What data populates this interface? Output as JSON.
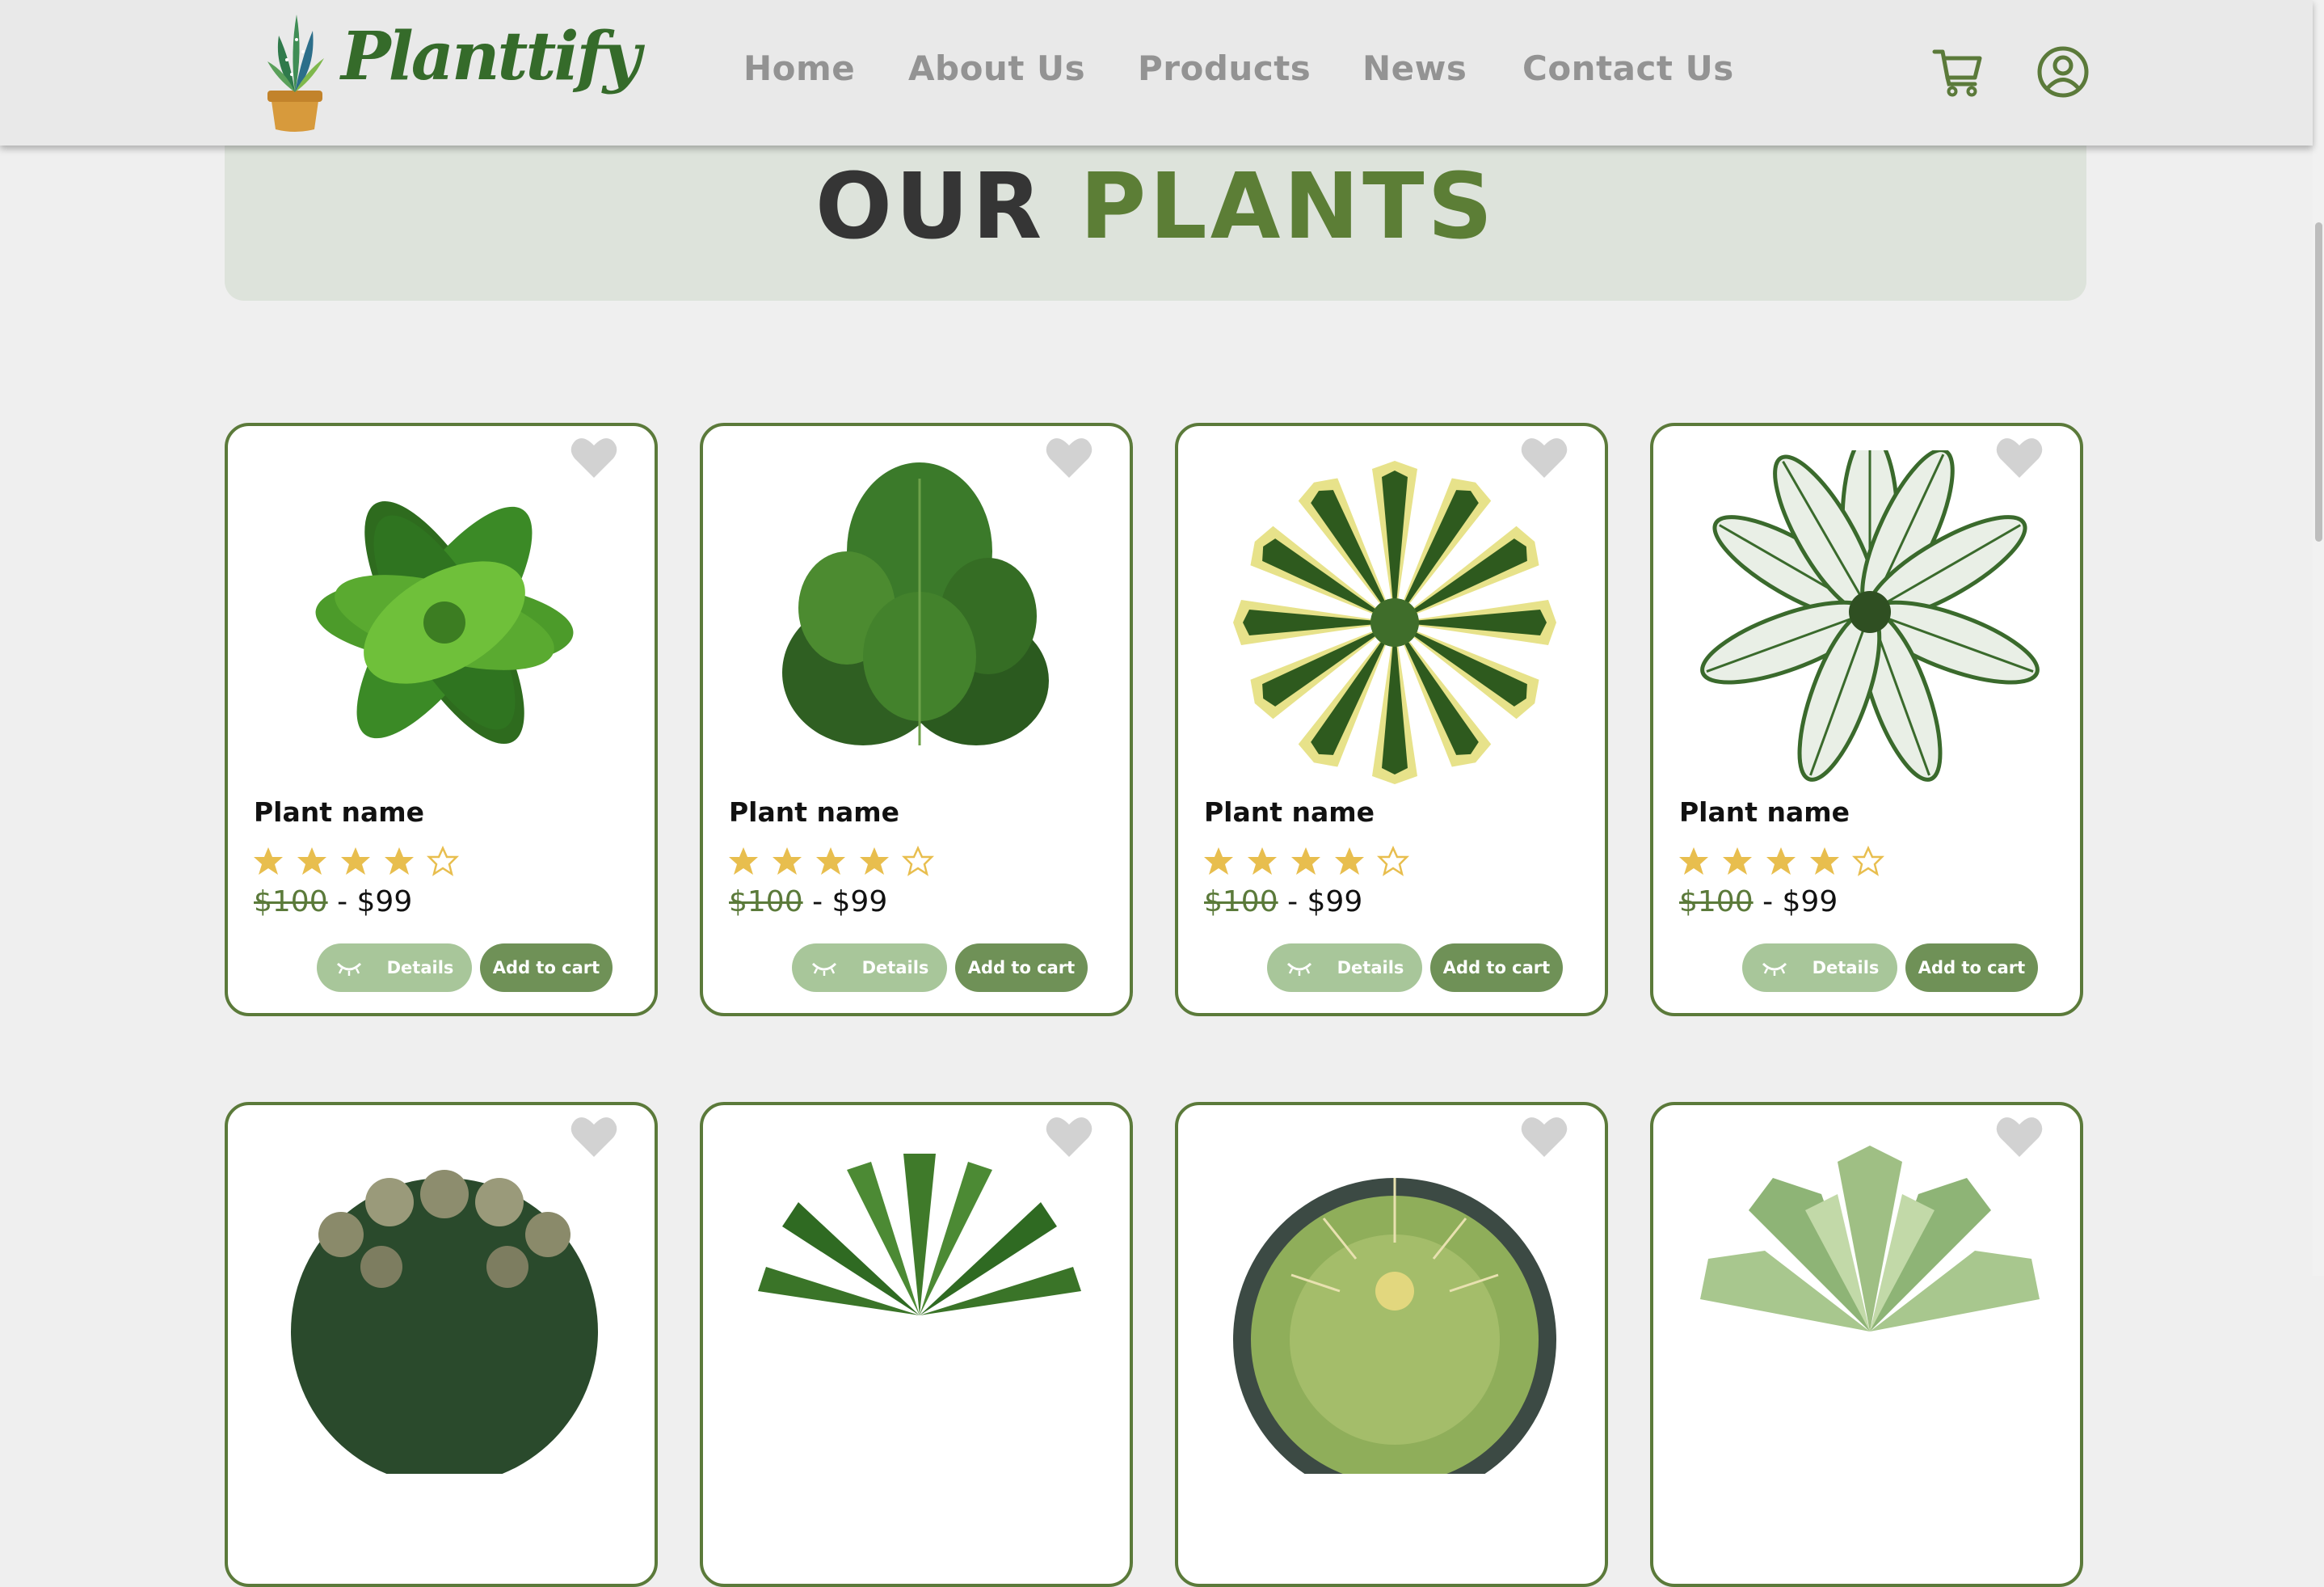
{
  "brand": {
    "name": "Planttify"
  },
  "nav": [
    "Home",
    "About Us",
    "Products",
    "News",
    "Contact Us"
  ],
  "banner": {
    "title_part1": "OUR",
    "title_part2": "PLANTS"
  },
  "products": [
    {
      "name": "Plant name",
      "rating": 4,
      "old_price": "$100",
      "separator": "-",
      "price": "$99",
      "details_label": "Details",
      "cart_label": "Add to cart"
    },
    {
      "name": "Plant name",
      "rating": 4,
      "old_price": "$100",
      "separator": "-",
      "price": "$99",
      "details_label": "Details",
      "cart_label": "Add to cart"
    },
    {
      "name": "Plant name",
      "rating": 4,
      "old_price": "$100",
      "separator": "-",
      "price": "$99",
      "details_label": "Details",
      "cart_label": "Add to cart"
    },
    {
      "name": "Plant name",
      "rating": 4,
      "old_price": "$100",
      "separator": "-",
      "price": "$99",
      "details_label": "Details",
      "cart_label": "Add to cart"
    }
  ],
  "colors": {
    "brand_green": "#5b7a3a",
    "banner_bg": "#dde3db",
    "details_button": "#a8c69a",
    "cart_button": "#6f9157",
    "star": "#e8be4e"
  }
}
